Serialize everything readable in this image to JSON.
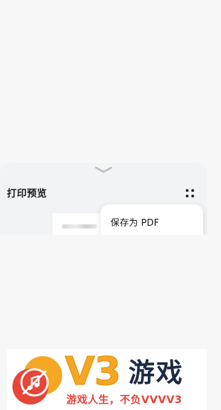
{
  "sheet": {
    "title": "打印预览",
    "collapse_icon": "chevron-down-icon",
    "more_icon": "more-dots-icon"
  },
  "menu": {
    "items": [
      {
        "label": "保存为 PDF"
      }
    ]
  },
  "watermark": {
    "brand": "V3",
    "word": "游戏",
    "slogan": "游戏人生，不负VVVV3",
    "colors": {
      "orange": "#f5a623",
      "red": "#e6453a",
      "navy": "#1e2a44"
    }
  }
}
